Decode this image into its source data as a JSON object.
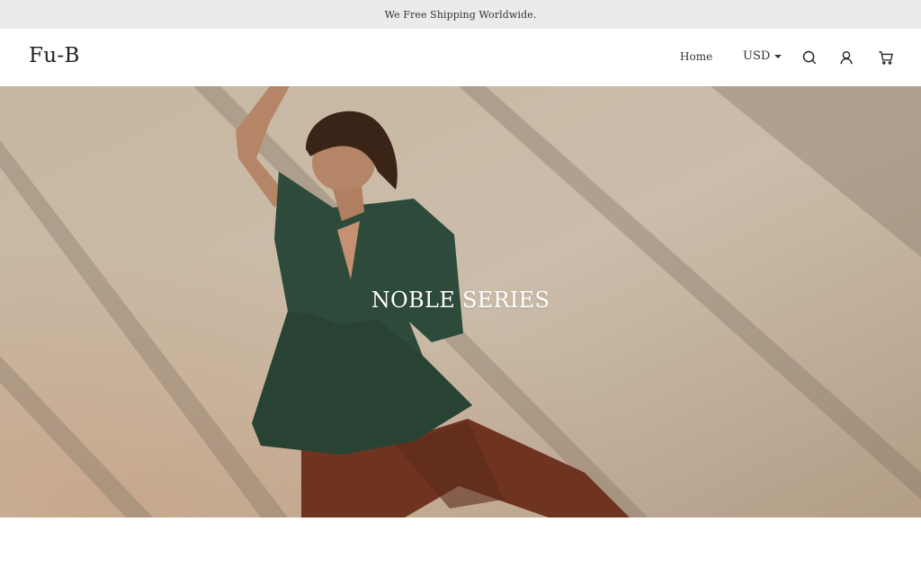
{
  "announcement": {
    "text": "We Free Shipping Worldwide."
  },
  "header": {
    "logo": "Fu-B",
    "nav": {
      "home_label": "Home"
    },
    "currency": {
      "selected": "USD"
    },
    "icons": [
      "search-icon",
      "account-icon",
      "cart-icon"
    ]
  },
  "hero": {
    "title": "NOBLE SERIES"
  },
  "colors": {
    "announcement_bg": "#ebebeb",
    "header_bg": "#ffffff",
    "hero_wall": "#c9bba8",
    "blouse_green": "#2e4a3b",
    "trousers_rust": "#6f3420"
  }
}
